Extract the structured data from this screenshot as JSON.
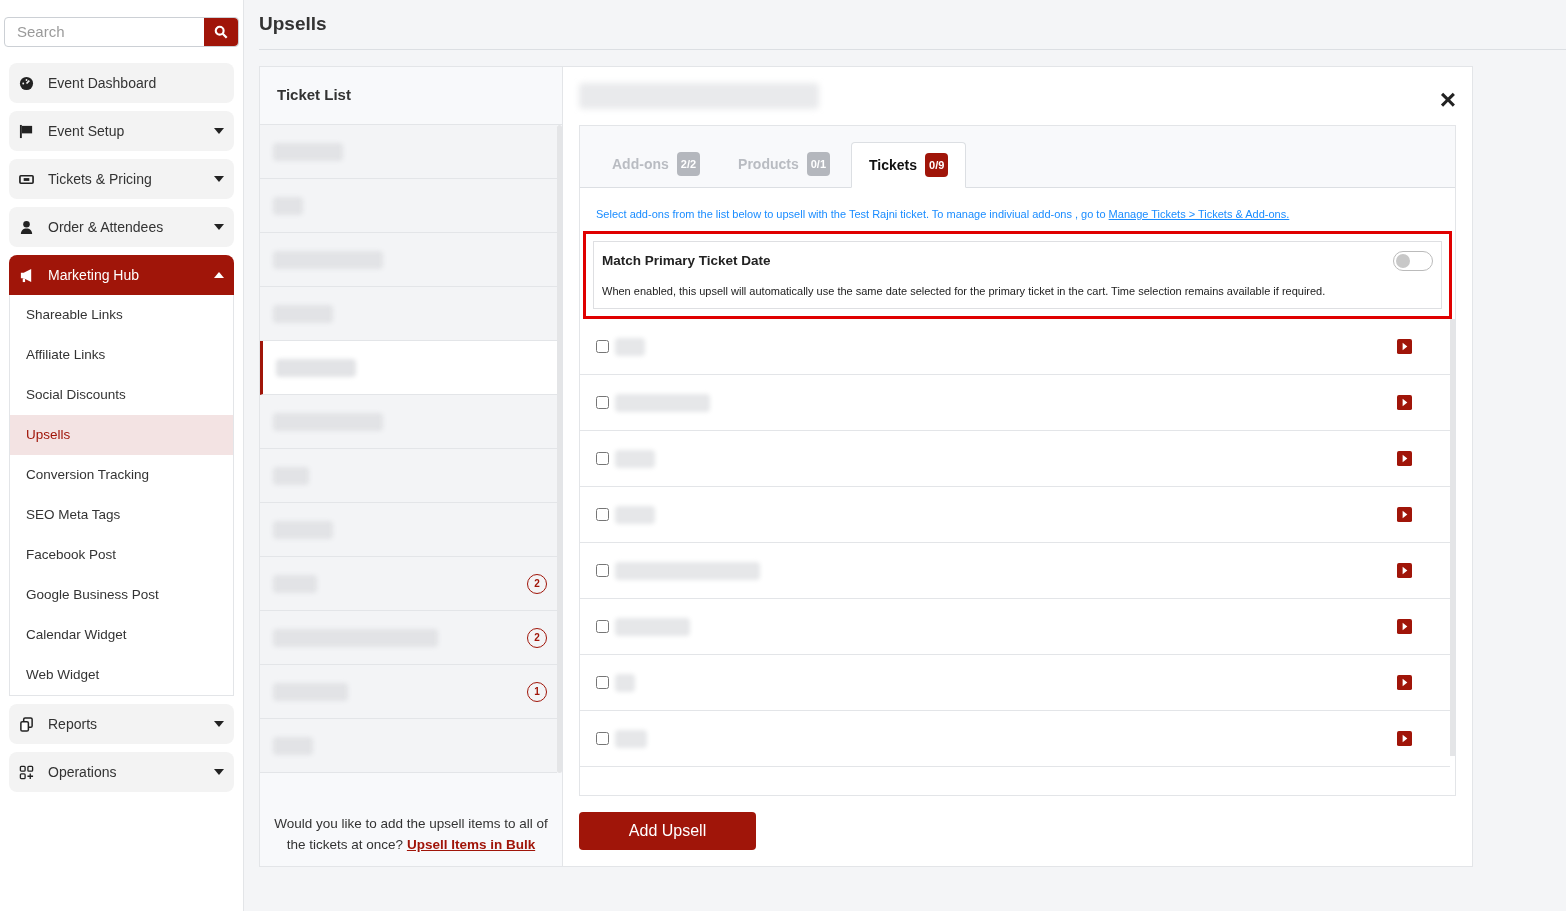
{
  "sidebar": {
    "search": {
      "placeholder": "Search"
    },
    "items": [
      {
        "label": "Event Dashboard",
        "selected": false
      },
      {
        "label": "Event Setup",
        "expanded": false,
        "selected": false
      },
      {
        "label": "Tickets & Pricing",
        "expanded": false,
        "selected": false
      },
      {
        "label": "Order & Attendees",
        "expanded": false,
        "selected": false
      },
      {
        "label": "Marketing Hub",
        "expanded": true,
        "selected": true,
        "children": [
          {
            "label": "Shareable Links",
            "selected": false
          },
          {
            "label": "Affiliate Links",
            "selected": false
          },
          {
            "label": "Social Discounts",
            "selected": false
          },
          {
            "label": "Upsells",
            "selected": true
          },
          {
            "label": "Conversion Tracking",
            "selected": false
          },
          {
            "label": "SEO Meta Tags",
            "selected": false
          },
          {
            "label": "Facebook Post",
            "selected": false
          },
          {
            "label": "Google Business Post",
            "selected": false
          },
          {
            "label": "Calendar Widget",
            "selected": false
          },
          {
            "label": "Web Widget",
            "selected": false
          }
        ]
      },
      {
        "label": "Reports",
        "expanded": false,
        "selected": false
      },
      {
        "label": "Operations",
        "expanded": false,
        "selected": false
      }
    ]
  },
  "page_title": "Upsells",
  "ticket_list": {
    "title": "Ticket List",
    "rows": [
      {
        "selected": false
      },
      {
        "selected": false
      },
      {
        "selected": false
      },
      {
        "selected": false
      },
      {
        "selected": true
      },
      {
        "selected": false
      },
      {
        "selected": false
      },
      {
        "selected": false
      },
      {
        "selected": false,
        "badge": "2"
      },
      {
        "selected": false,
        "badge": "2"
      },
      {
        "selected": false,
        "badge": "1"
      },
      {
        "selected": false
      }
    ],
    "bulk_note": "Would you like to add the upsell items to all of the tickets at once?",
    "bulk_link": "Upsell Items in Bulk"
  },
  "panel": {
    "close": "×",
    "tabs": [
      {
        "label": "Add-ons",
        "count": "2/2",
        "selected": false
      },
      {
        "label": "Products",
        "count": "0/1",
        "selected": false
      },
      {
        "label": "Tickets",
        "count": "0/9",
        "selected": true
      }
    ],
    "info": "Select add-ons from the list below to upsell with the Test Rajni ticket. To manage indiviual add-ons , go to",
    "info_link": "Manage Tickets > Tickets & Add-ons.",
    "match_date": {
      "title": "Match Primary Ticket Date",
      "description": "When enabled, this upsell will automatically use the same date selected for the primary ticket in the cart. Time selection remains available if required.",
      "on": false
    },
    "items": [
      {
        "checked": false
      },
      {
        "checked": false
      },
      {
        "checked": false
      },
      {
        "checked": false
      },
      {
        "checked": false
      },
      {
        "checked": false
      },
      {
        "checked": false
      },
      {
        "checked": false
      }
    ],
    "add_button": "Add Upsell"
  }
}
